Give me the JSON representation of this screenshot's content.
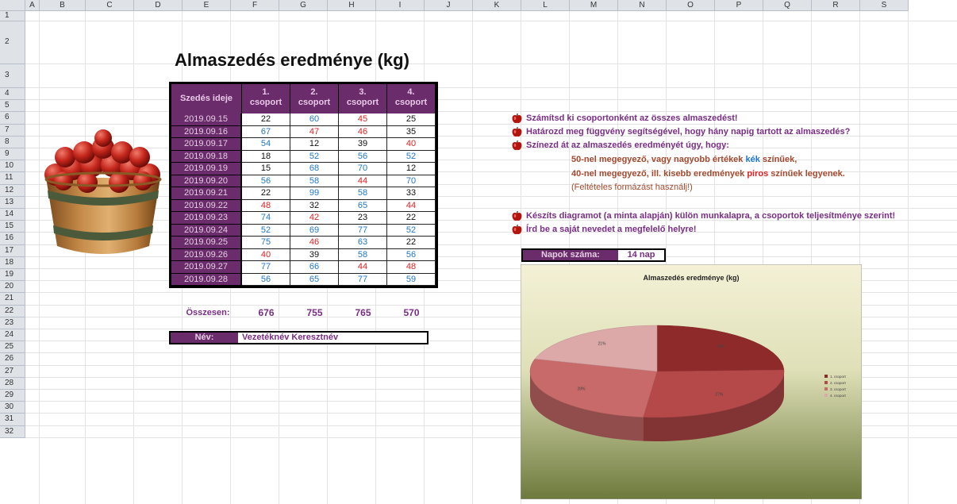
{
  "columns": [
    "A",
    "B",
    "C",
    "D",
    "E",
    "F",
    "G",
    "H",
    "I",
    "J",
    "K",
    "L",
    "M",
    "N",
    "O",
    "P",
    "Q",
    "R",
    "S"
  ],
  "rows": [
    "1",
    "2",
    "3",
    "4",
    "5",
    "6",
    "7",
    "8",
    "9",
    "10",
    "11",
    "12",
    "13",
    "14",
    "15",
    "16",
    "17",
    "18",
    "19",
    "20",
    "21",
    "22",
    "23",
    "24",
    "25",
    "26",
    "27",
    "28",
    "29",
    "30",
    "31",
    "32"
  ],
  "title": "Almaszedés eredménye (kg)",
  "table": {
    "headers": {
      "date": "Szedés ideje",
      "groups": [
        {
          "num": "1.",
          "word": "csoport"
        },
        {
          "num": "2.",
          "word": "csoport"
        },
        {
          "num": "3.",
          "word": "csoport"
        },
        {
          "num": "4.",
          "word": "csoport"
        }
      ]
    },
    "rows": [
      {
        "date": "2019.09.15",
        "v": [
          "22",
          "60",
          "45",
          "25"
        ]
      },
      {
        "date": "2019.09.16",
        "v": [
          "67",
          "47",
          "46",
          "35"
        ]
      },
      {
        "date": "2019.09.17",
        "v": [
          "54",
          "12",
          "39",
          "40"
        ]
      },
      {
        "date": "2019.09.18",
        "v": [
          "18",
          "52",
          "56",
          "52"
        ]
      },
      {
        "date": "2019.09.19",
        "v": [
          "15",
          "68",
          "70",
          "12"
        ]
      },
      {
        "date": "2019.09.20",
        "v": [
          "56",
          "58",
          "44",
          "70"
        ]
      },
      {
        "date": "2019.09.21",
        "v": [
          "22",
          "99",
          "58",
          "33"
        ]
      },
      {
        "date": "2019.09.22",
        "v": [
          "48",
          "32",
          "65",
          "44"
        ]
      },
      {
        "date": "2019.09.23",
        "v": [
          "74",
          "42",
          "23",
          "22"
        ]
      },
      {
        "date": "2019.09.24",
        "v": [
          "52",
          "69",
          "77",
          "52"
        ]
      },
      {
        "date": "2019.09.25",
        "v": [
          "75",
          "46",
          "63",
          "22"
        ]
      },
      {
        "date": "2019.09.26",
        "v": [
          "40",
          "39",
          "58",
          "56"
        ]
      },
      {
        "date": "2019.09.27",
        "v": [
          "77",
          "66",
          "44",
          "48"
        ]
      },
      {
        "date": "2019.09.28",
        "v": [
          "56",
          "65",
          "77",
          "59"
        ]
      }
    ],
    "colors": [
      [
        "black",
        "blue",
        "red",
        "black"
      ],
      [
        "blue",
        "red",
        "red",
        "black"
      ],
      [
        "blue",
        "black",
        "black",
        "red"
      ],
      [
        "black",
        "blue",
        "blue",
        "blue"
      ],
      [
        "black",
        "blue",
        "blue",
        "black"
      ],
      [
        "blue",
        "blue",
        "red",
        "blue"
      ],
      [
        "black",
        "blue",
        "blue",
        "black"
      ],
      [
        "red",
        "black",
        "blue",
        "red"
      ],
      [
        "blue",
        "red",
        "black",
        "black"
      ],
      [
        "blue",
        "blue",
        "blue",
        "blue"
      ],
      [
        "blue",
        "red",
        "blue",
        "black"
      ],
      [
        "red",
        "black",
        "blue",
        "blue"
      ],
      [
        "blue",
        "blue",
        "red",
        "red"
      ],
      [
        "blue",
        "blue",
        "blue",
        "blue"
      ]
    ],
    "totals_label": "Összesen:",
    "totals": [
      "676",
      "755",
      "765",
      "570"
    ]
  },
  "name_row": {
    "label": "Név:",
    "value": "Vezetéknév Keresztnév"
  },
  "instructions": {
    "i1": "Számítsd ki csoportonként az összes almaszedést!",
    "i2": "Határozd meg függvény segítségével, hogy hány napig tartott az almaszedés?",
    "i3": "Színezd át az almaszedés eredményét úgy, hogy:",
    "s1a": "50-nel megegyező, vagy nagyobb értékek ",
    "s1b": "kék",
    "s1c": " színűek,",
    "s2a": "40-nel megegyező, ill.  kisebb eredmények ",
    "s2b": "piros",
    "s2c": " színűek legyenek.",
    "note": "(Feltételes formázást használj!)",
    "i4": "Készíts diagramot (a minta alapján) külön munkalapra, a csoportok teljesítménye szerint!",
    "i5": "Írd be a saját nevedet a megfelelő helyre!"
  },
  "napok": {
    "label": "Napok száma:",
    "value": "14 nap"
  },
  "colors": {
    "purple": "#6b2c6b",
    "text_purple": "#7a2d86",
    "blue": "#1f78c8",
    "red": "#e02020"
  },
  "chart_data": {
    "type": "pie",
    "title": "Almaszedés eredménye (kg)",
    "categories": [
      "1. csoport",
      "2. csoport",
      "3. csoport",
      "4. csoport"
    ],
    "values": [
      676,
      755,
      765,
      570
    ],
    "labels": [
      "24%",
      "27%",
      "28%",
      "21%"
    ],
    "legend": [
      "1. csoport",
      "2. csoport",
      "3. csoport",
      "4. csoport"
    ],
    "legend_position": "right",
    "slice_colors": [
      "#8e2a2a",
      "#b54848",
      "#c96a6a",
      "#dca8a8"
    ]
  }
}
